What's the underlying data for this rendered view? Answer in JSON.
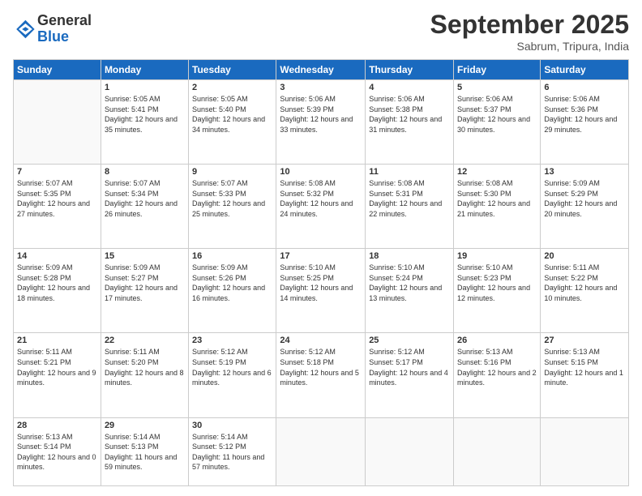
{
  "header": {
    "logo_line1": "General",
    "logo_line2": "Blue",
    "month": "September 2025",
    "location": "Sabrum, Tripura, India"
  },
  "weekdays": [
    "Sunday",
    "Monday",
    "Tuesday",
    "Wednesday",
    "Thursday",
    "Friday",
    "Saturday"
  ],
  "weeks": [
    [
      {
        "day": "",
        "sunrise": "",
        "sunset": "",
        "daylight": ""
      },
      {
        "day": "1",
        "sunrise": "Sunrise: 5:05 AM",
        "sunset": "Sunset: 5:41 PM",
        "daylight": "Daylight: 12 hours and 35 minutes."
      },
      {
        "day": "2",
        "sunrise": "Sunrise: 5:05 AM",
        "sunset": "Sunset: 5:40 PM",
        "daylight": "Daylight: 12 hours and 34 minutes."
      },
      {
        "day": "3",
        "sunrise": "Sunrise: 5:06 AM",
        "sunset": "Sunset: 5:39 PM",
        "daylight": "Daylight: 12 hours and 33 minutes."
      },
      {
        "day": "4",
        "sunrise": "Sunrise: 5:06 AM",
        "sunset": "Sunset: 5:38 PM",
        "daylight": "Daylight: 12 hours and 31 minutes."
      },
      {
        "day": "5",
        "sunrise": "Sunrise: 5:06 AM",
        "sunset": "Sunset: 5:37 PM",
        "daylight": "Daylight: 12 hours and 30 minutes."
      },
      {
        "day": "6",
        "sunrise": "Sunrise: 5:06 AM",
        "sunset": "Sunset: 5:36 PM",
        "daylight": "Daylight: 12 hours and 29 minutes."
      }
    ],
    [
      {
        "day": "7",
        "sunrise": "Sunrise: 5:07 AM",
        "sunset": "Sunset: 5:35 PM",
        "daylight": "Daylight: 12 hours and 27 minutes."
      },
      {
        "day": "8",
        "sunrise": "Sunrise: 5:07 AM",
        "sunset": "Sunset: 5:34 PM",
        "daylight": "Daylight: 12 hours and 26 minutes."
      },
      {
        "day": "9",
        "sunrise": "Sunrise: 5:07 AM",
        "sunset": "Sunset: 5:33 PM",
        "daylight": "Daylight: 12 hours and 25 minutes."
      },
      {
        "day": "10",
        "sunrise": "Sunrise: 5:08 AM",
        "sunset": "Sunset: 5:32 PM",
        "daylight": "Daylight: 12 hours and 24 minutes."
      },
      {
        "day": "11",
        "sunrise": "Sunrise: 5:08 AM",
        "sunset": "Sunset: 5:31 PM",
        "daylight": "Daylight: 12 hours and 22 minutes."
      },
      {
        "day": "12",
        "sunrise": "Sunrise: 5:08 AM",
        "sunset": "Sunset: 5:30 PM",
        "daylight": "Daylight: 12 hours and 21 minutes."
      },
      {
        "day": "13",
        "sunrise": "Sunrise: 5:09 AM",
        "sunset": "Sunset: 5:29 PM",
        "daylight": "Daylight: 12 hours and 20 minutes."
      }
    ],
    [
      {
        "day": "14",
        "sunrise": "Sunrise: 5:09 AM",
        "sunset": "Sunset: 5:28 PM",
        "daylight": "Daylight: 12 hours and 18 minutes."
      },
      {
        "day": "15",
        "sunrise": "Sunrise: 5:09 AM",
        "sunset": "Sunset: 5:27 PM",
        "daylight": "Daylight: 12 hours and 17 minutes."
      },
      {
        "day": "16",
        "sunrise": "Sunrise: 5:09 AM",
        "sunset": "Sunset: 5:26 PM",
        "daylight": "Daylight: 12 hours and 16 minutes."
      },
      {
        "day": "17",
        "sunrise": "Sunrise: 5:10 AM",
        "sunset": "Sunset: 5:25 PM",
        "daylight": "Daylight: 12 hours and 14 minutes."
      },
      {
        "day": "18",
        "sunrise": "Sunrise: 5:10 AM",
        "sunset": "Sunset: 5:24 PM",
        "daylight": "Daylight: 12 hours and 13 minutes."
      },
      {
        "day": "19",
        "sunrise": "Sunrise: 5:10 AM",
        "sunset": "Sunset: 5:23 PM",
        "daylight": "Daylight: 12 hours and 12 minutes."
      },
      {
        "day": "20",
        "sunrise": "Sunrise: 5:11 AM",
        "sunset": "Sunset: 5:22 PM",
        "daylight": "Daylight: 12 hours and 10 minutes."
      }
    ],
    [
      {
        "day": "21",
        "sunrise": "Sunrise: 5:11 AM",
        "sunset": "Sunset: 5:21 PM",
        "daylight": "Daylight: 12 hours and 9 minutes."
      },
      {
        "day": "22",
        "sunrise": "Sunrise: 5:11 AM",
        "sunset": "Sunset: 5:20 PM",
        "daylight": "Daylight: 12 hours and 8 minutes."
      },
      {
        "day": "23",
        "sunrise": "Sunrise: 5:12 AM",
        "sunset": "Sunset: 5:19 PM",
        "daylight": "Daylight: 12 hours and 6 minutes."
      },
      {
        "day": "24",
        "sunrise": "Sunrise: 5:12 AM",
        "sunset": "Sunset: 5:18 PM",
        "daylight": "Daylight: 12 hours and 5 minutes."
      },
      {
        "day": "25",
        "sunrise": "Sunrise: 5:12 AM",
        "sunset": "Sunset: 5:17 PM",
        "daylight": "Daylight: 12 hours and 4 minutes."
      },
      {
        "day": "26",
        "sunrise": "Sunrise: 5:13 AM",
        "sunset": "Sunset: 5:16 PM",
        "daylight": "Daylight: 12 hours and 2 minutes."
      },
      {
        "day": "27",
        "sunrise": "Sunrise: 5:13 AM",
        "sunset": "Sunset: 5:15 PM",
        "daylight": "Daylight: 12 hours and 1 minute."
      }
    ],
    [
      {
        "day": "28",
        "sunrise": "Sunrise: 5:13 AM",
        "sunset": "Sunset: 5:14 PM",
        "daylight": "Daylight: 12 hours and 0 minutes."
      },
      {
        "day": "29",
        "sunrise": "Sunrise: 5:14 AM",
        "sunset": "Sunset: 5:13 PM",
        "daylight": "Daylight: 11 hours and 59 minutes."
      },
      {
        "day": "30",
        "sunrise": "Sunrise: 5:14 AM",
        "sunset": "Sunset: 5:12 PM",
        "daylight": "Daylight: 11 hours and 57 minutes."
      },
      {
        "day": "",
        "sunrise": "",
        "sunset": "",
        "daylight": ""
      },
      {
        "day": "",
        "sunrise": "",
        "sunset": "",
        "daylight": ""
      },
      {
        "day": "",
        "sunrise": "",
        "sunset": "",
        "daylight": ""
      },
      {
        "day": "",
        "sunrise": "",
        "sunset": "",
        "daylight": ""
      }
    ]
  ]
}
